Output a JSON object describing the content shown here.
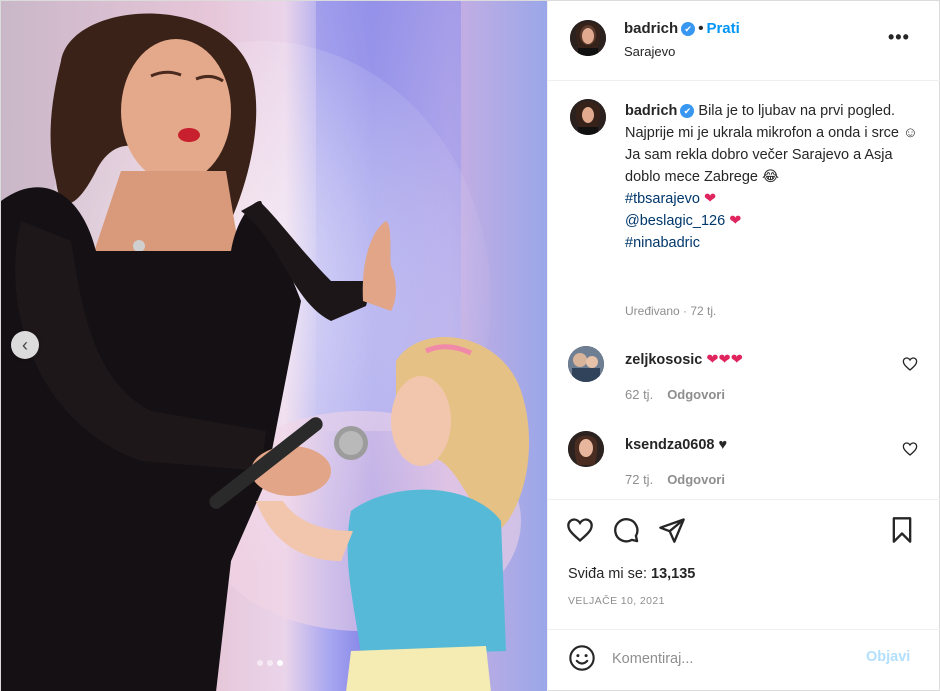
{
  "post": {
    "author": "badrich",
    "verified": true,
    "follow_label": "Prati",
    "location": "Sarajevo",
    "more_icon": "more-options-icon",
    "caption": {
      "line1": "Bila je to ljubav na prvi pogled.",
      "line2": "Najprije mi je ukrala mikrofon a onda i srce",
      "line2_emoji": "☺",
      "line3": "Ja sam rekla dobro večer Sarajevo a Asja doblo mece Zabrege",
      "line3_emoji": "😂",
      "hashtag1": "#tbsarajevo",
      "mention": "@beslagic_126",
      "hashtag2": "#ninabadric",
      "heart": "❤"
    },
    "edited_label": "Uređivano",
    "edited_time": "72 tj.",
    "likes_label": "Sviđa mi se:",
    "likes_count": "13,135",
    "date": "VELJAČE 10, 2021",
    "carousel": {
      "slides": 3,
      "active": 3
    }
  },
  "comments": [
    {
      "user": "zeljkososic",
      "text": "❤❤❤",
      "time": "62 tj.",
      "reply_label": "Odgovori"
    },
    {
      "user": "ksendza0608",
      "text": "♥",
      "time": "72 tj.",
      "reply_label": "Odgovori"
    }
  ],
  "composer": {
    "placeholder": "Komentiraj...",
    "post_label": "Objavi"
  },
  "colors": {
    "accent": "#0095f6",
    "link": "#00376b",
    "muted": "#8e8e8e",
    "heart": "#e0245e"
  }
}
